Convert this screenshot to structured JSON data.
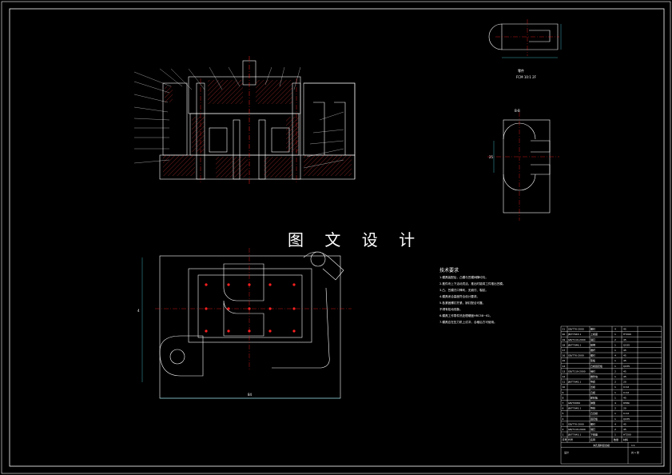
{
  "watermark": "图 文 设 计",
  "colors": {
    "background": "#000000",
    "outline": "#ffffff",
    "centerline": "#ff2020",
    "dimension": "#4dd8e8",
    "hatch": "#c83232"
  },
  "view_labels": {
    "section_view_label": "A—A",
    "top_right_caption": "零件",
    "top_right_subcaption": "FCM 10:1 2F",
    "mid_right_caption": "B-B",
    "dim_bottom": "84",
    "dim_left": "4",
    "dim_side": "25"
  },
  "requirements": {
    "title": "技术要求",
    "lines": [
      "1.模具装配后，凸模与凹模间隙均匀。",
      "2.推件块上下活动灵活，推出时能将工件推出凹模。",
      "3.凸、凹模刃口锋利，无崩刃、裂纹。",
      "4.模具闭合高度符合设计要求。",
      "5.各紧固螺钉拧紧，销钉配合可靠，",
      "   不得有松动现象。",
      "6.模具工作零件热处理硬度HRC58~62。",
      "7.模具应在压力机上试冲，合格后方可使用。"
    ]
  },
  "parts_list": {
    "rows": [
      [
        "21",
        "GB/T70-2000",
        "螺钉",
        "4",
        "45"
      ],
      [
        "20",
        "JB/T7643.1",
        "上模座",
        "1",
        "HT200"
      ],
      [
        "19",
        "GB/T119-2000",
        "销钉",
        "2",
        "45"
      ],
      [
        "18",
        "JB/T7646.1",
        "模柄",
        "1",
        "Q235"
      ],
      [
        "17",
        "",
        "推杆",
        "1",
        "45"
      ],
      [
        "16",
        "GB/T70-2000",
        "螺钉",
        "4",
        "45"
      ],
      [
        "15",
        "",
        "垫板",
        "1",
        "45"
      ],
      [
        "14",
        "",
        "凸模固定板",
        "1",
        "Q235"
      ],
      [
        "13",
        "GB/T119-2000",
        "销钉",
        "2",
        "45"
      ],
      [
        "12",
        "",
        "推件块",
        "1",
        "45"
      ],
      [
        "11",
        "JB/T7645.1",
        "导套",
        "2",
        "20"
      ],
      [
        "10",
        "",
        "凹模",
        "1",
        "Cr12"
      ],
      [
        "9",
        "",
        "凸模",
        "1",
        "Cr12"
      ],
      [
        "8",
        "",
        "卸料板",
        "1",
        "45"
      ],
      [
        "7",
        "GB/T2089",
        "弹簧",
        "4",
        "65Mn"
      ],
      [
        "6",
        "JB/T7645.1",
        "导柱",
        "2",
        "20"
      ],
      [
        "5",
        "",
        "凸凹模",
        "1",
        "Cr12"
      ],
      [
        "4",
        "",
        "固定板",
        "1",
        "Q235"
      ],
      [
        "3",
        "GB/T70-2000",
        "螺钉",
        "4",
        "45"
      ],
      [
        "2",
        "GB/T119-2000",
        "销钉",
        "2",
        "45"
      ],
      [
        "1",
        "JB/T7643.1",
        "下模座",
        "1",
        "HT200"
      ]
    ],
    "header": [
      "序号",
      "代号",
      "名称",
      "数量",
      "材料"
    ],
    "title_block": {
      "drawing_name": "冲孔落料复合模",
      "scale": "1:1",
      "sheet": "共 1 张",
      "school": "设计"
    }
  }
}
